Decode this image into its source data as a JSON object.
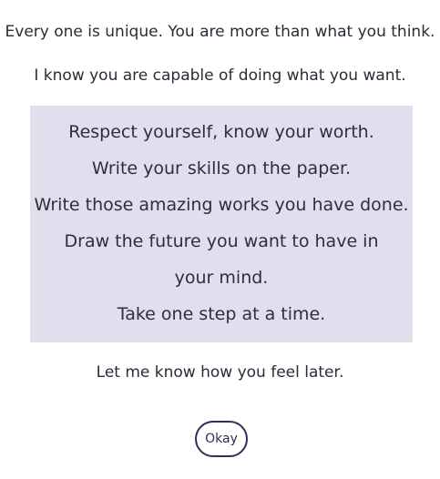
{
  "intro": {
    "line1": "Every one is unique. You are more than what you think.",
    "line2": "I know you are capable of doing what you want."
  },
  "card": {
    "lines": [
      "Respect yourself, know your worth.",
      "Write your skills on the paper.",
      "Write those amazing works you have done.",
      "Draw the future you want to have in your mind.",
      "Take one step at a time."
    ]
  },
  "closing": "Let me know how you feel later.",
  "button": {
    "label": "Okay"
  },
  "colors": {
    "card_background": "#e0dfed",
    "button_border": "#2f2f57",
    "text": "#2b2b3a"
  }
}
